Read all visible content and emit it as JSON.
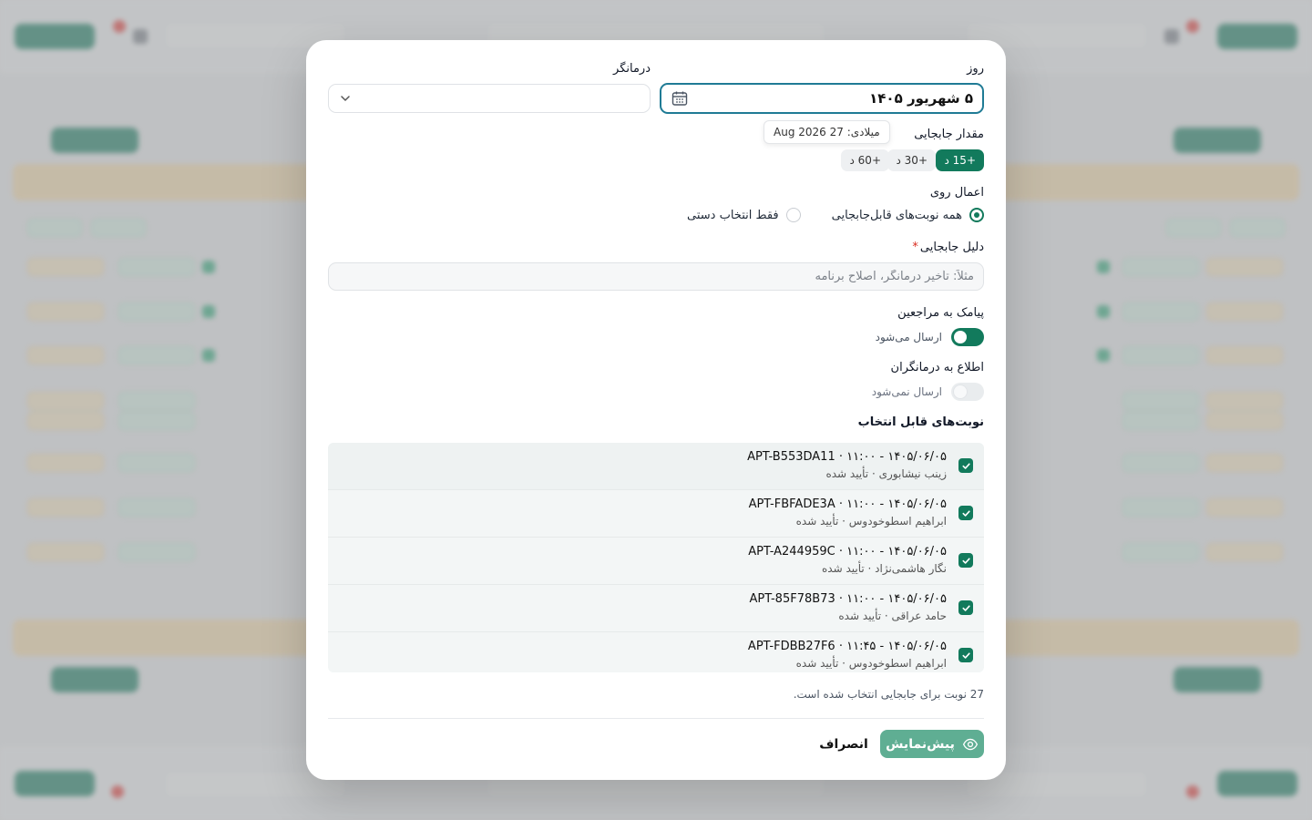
{
  "modal": {
    "day_label": "روز",
    "date_value": "۵ شهریور ۱۴۰۵",
    "therapist_label": "درمانگر",
    "therapist_value": "",
    "tooltip": "میلادی: 27 Aug 2026",
    "shift_label": "مقدار جابجایی",
    "shift_options": [
      "+15 د",
      "+30 د",
      "+60 د"
    ],
    "shift_selected": "+15 د",
    "apply_label": "اعمال روی",
    "apply_all": "همه نوبت‌های قابل‌جابجایی",
    "apply_manual": "فقط انتخاب دستی",
    "reason_label": "دلیل جابجایی",
    "reason_required_mark": "*",
    "reason_placeholder": "مثلاً: تأخیر درمانگر، اصلاح برنامه",
    "sms_label": "پیامک به مراجعین",
    "sms_status": "ارسال می‌شود",
    "sms_on": true,
    "notify_label": "اطلاع به درمانگران",
    "notify_status": "ارسال نمی‌شود",
    "notify_on": false,
    "appointments_label": "نوبت‌های قابل انتخاب",
    "appointments": [
      {
        "title": "APT-B553DA11 · ۱۱:۰۰ - ۱۴۰۵/۰۶/۰۵",
        "subtitle": "زینب نیشابوری · تأیید شده"
      },
      {
        "title": "APT-FBFADE3A · ۱۱:۰۰ - ۱۴۰۵/۰۶/۰۵",
        "subtitle": "ابراهیم اسطوخودوس · تأیید شده"
      },
      {
        "title": "APT-A244959C · ۱۱:۰۰ - ۱۴۰۵/۰۶/۰۵",
        "subtitle": "نگار هاشمی‌نژاد · تأیید شده"
      },
      {
        "title": "APT-85F78B73 · ۱۱:۰۰ - ۱۴۰۵/۰۶/۰۵",
        "subtitle": "حامد عراقی · تأیید شده"
      },
      {
        "title": "APT-FDBB27F6 · ۱۱:۴۵ - ۱۴۰۵/۰۶/۰۵",
        "subtitle": "ابراهیم اسطوخودوس · تأیید شده"
      }
    ],
    "summary": "27 نوبت برای جابجایی انتخاب شده است.",
    "preview_button": "پیش‌نمایش",
    "cancel_button": "انصراف"
  },
  "colors": {
    "primary": "#127a5c",
    "primary_light": "#5fae93",
    "focus_border": "#1f7b95",
    "required": "#d92d20"
  }
}
